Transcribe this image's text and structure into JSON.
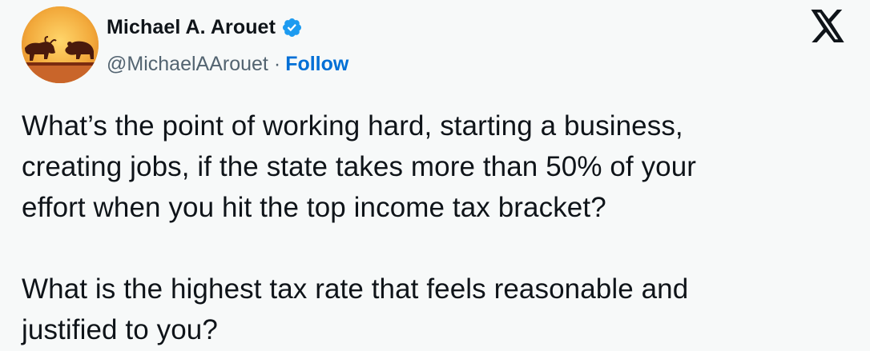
{
  "author": {
    "display_name": "Michael A. Arouet",
    "handle": "@MichaelAArouet",
    "separator": "·",
    "follow_label": "Follow",
    "verified_icon": "verified-badge-icon",
    "avatar_icon": "bull-and-bear-silhouette-avatar"
  },
  "platform": {
    "logo_icon": "x-logo-icon"
  },
  "tweet": {
    "paragraphs": [
      "What’s the point of working hard, starting a business,\ncreating jobs, if the state takes more than 50% of your\neffort when you hit the top income tax bracket?",
      "What is the highest tax rate that feels reasonable and\njustified to you?"
    ]
  },
  "colors": {
    "background": "#f7f9f9",
    "text": "#0f1419",
    "secondary_text": "#536471",
    "link": "#006fd6",
    "verified": "#1d9bf0"
  }
}
